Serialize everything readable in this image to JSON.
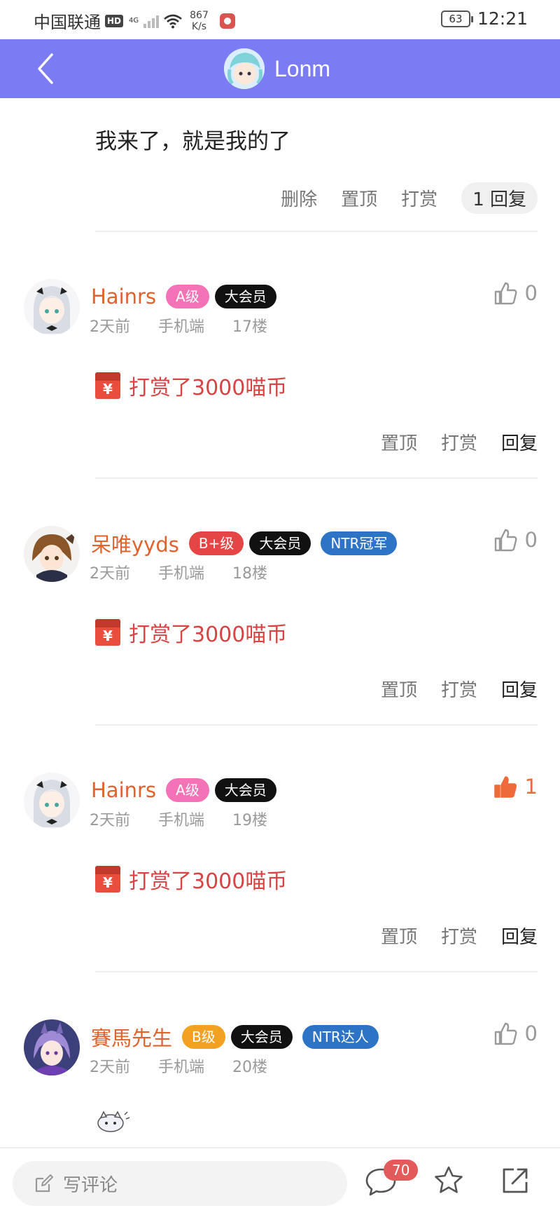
{
  "status_bar": {
    "carrier": "中国联通",
    "hd": "HD",
    "network": "4G",
    "speed_value": "867",
    "speed_unit": "K/s",
    "battery": "63",
    "time": "12:21"
  },
  "header": {
    "title": "Lonm",
    "accent_color": "#7b7cf4"
  },
  "post": {
    "text": "我来了，就是我的了",
    "actions": {
      "delete": "删除",
      "pin": "置顶",
      "tip": "打赏",
      "reply_count": "1 回复"
    }
  },
  "comments": [
    {
      "name": "Hainrs",
      "level": "A级",
      "vip": "大会员",
      "tag": "",
      "time": "2天前",
      "device": "手机端",
      "floor": "17楼",
      "likes": "0",
      "liked": false,
      "content": "打赏了3000喵币",
      "envelope_symbol": "¥",
      "pin": "置顶",
      "tip": "打赏",
      "reply": "回复"
    },
    {
      "name": "呆唯yyds",
      "level": "B+级",
      "vip": "大会员",
      "tag": "NTR冠军",
      "time": "2天前",
      "device": "手机端",
      "floor": "18楼",
      "likes": "0",
      "liked": false,
      "content": "打赏了3000喵币",
      "envelope_symbol": "¥",
      "pin": "置顶",
      "tip": "打赏",
      "reply": "回复"
    },
    {
      "name": "Hainrs",
      "level": "A级",
      "vip": "大会员",
      "tag": "",
      "time": "2天前",
      "device": "手机端",
      "floor": "19楼",
      "likes": "1",
      "liked": true,
      "content": "打赏了3000喵币",
      "envelope_symbol": "¥",
      "pin": "置顶",
      "tip": "打赏",
      "reply": "回复"
    },
    {
      "name": "賽馬先生",
      "level": "B级",
      "vip": "大会员",
      "tag": "NTR达人",
      "time": "2天前",
      "device": "手机端",
      "floor": "20楼",
      "likes": "0",
      "liked": false,
      "content": "",
      "pin": "",
      "tip": "",
      "reply": ""
    }
  ],
  "bottom_bar": {
    "input_placeholder": "写评论",
    "comment_count": "70"
  }
}
